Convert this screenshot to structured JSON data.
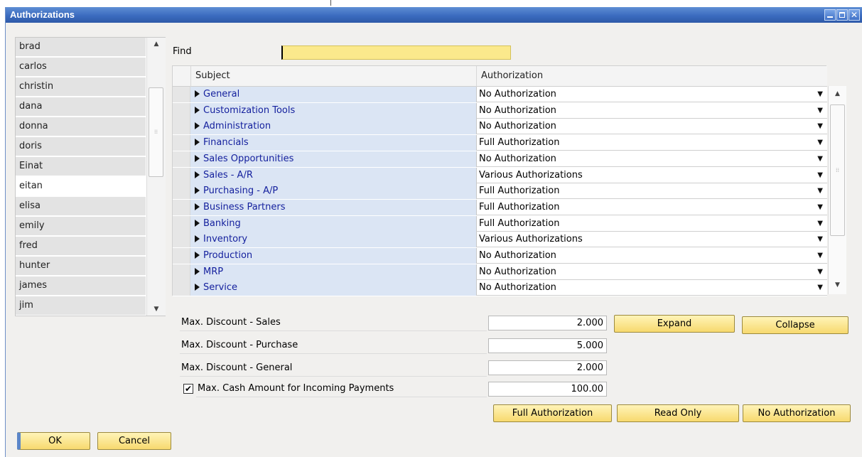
{
  "window": {
    "title": "Authorizations"
  },
  "users": [
    "brad",
    "carlos",
    "christin",
    "dana",
    "donna",
    "doris",
    "Einat",
    "eitan",
    "elisa",
    "emily",
    "fred",
    "hunter",
    "james",
    "jim"
  ],
  "find": {
    "label": "Find",
    "value": ""
  },
  "grid": {
    "headers": {
      "subject": "Subject",
      "authorization": "Authorization"
    },
    "rows": [
      {
        "subject": "General",
        "authorization": "No Authorization"
      },
      {
        "subject": "Customization Tools",
        "authorization": "No Authorization"
      },
      {
        "subject": "Administration",
        "authorization": "No Authorization"
      },
      {
        "subject": "Financials",
        "authorization": "Full Authorization"
      },
      {
        "subject": "Sales Opportunities",
        "authorization": "No Authorization"
      },
      {
        "subject": "Sales - A/R",
        "authorization": "Various Authorizations"
      },
      {
        "subject": "Purchasing - A/P",
        "authorization": "Full Authorization"
      },
      {
        "subject": "Business Partners",
        "authorization": "Full Authorization"
      },
      {
        "subject": "Banking",
        "authorization": "Full Authorization"
      },
      {
        "subject": "Inventory",
        "authorization": "Various Authorizations"
      },
      {
        "subject": "Production",
        "authorization": "No Authorization"
      },
      {
        "subject": "MRP",
        "authorization": "No Authorization"
      },
      {
        "subject": "Service",
        "authorization": "No Authorization"
      }
    ]
  },
  "fields": {
    "max_discount_sales": {
      "label": "Max. Discount - Sales",
      "value": "2.000"
    },
    "max_discount_purchase": {
      "label": "Max. Discount - Purchase",
      "value": "5.000"
    },
    "max_discount_general": {
      "label": "Max. Discount - General",
      "value": "2.000"
    },
    "max_cash_amount": {
      "label": "Max. Cash Amount for Incoming Payments",
      "value": "100.00",
      "checked": true
    }
  },
  "buttons": {
    "expand": "Expand",
    "collapse": "Collapse",
    "full_authorization": "Full Authorization",
    "read_only": "Read Only",
    "no_authorization": "No Authorization",
    "ok": "OK",
    "cancel": "Cancel"
  },
  "colors": {
    "accent": "#3b6bbf",
    "button": "#f7d96e",
    "find_field": "#fbe98c",
    "link": "#15219e"
  }
}
